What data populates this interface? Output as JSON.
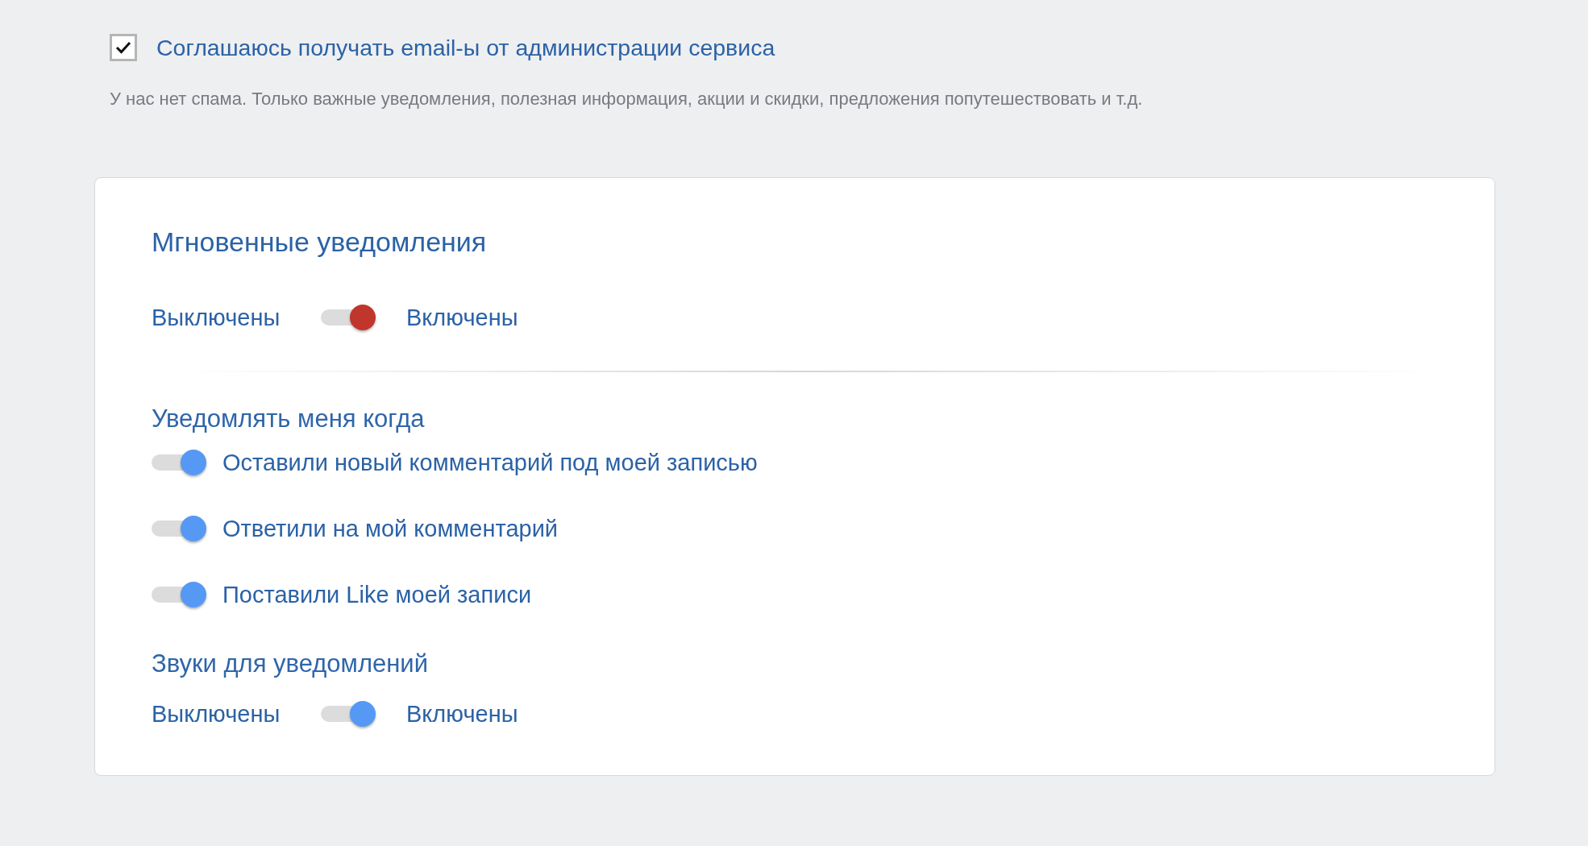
{
  "consent": {
    "label": "Соглашаюсь получать email-ы от администрации сервиса",
    "checked": true,
    "note": "У нас нет спама. Только важные уведомления, полезная информация, акции и скидки, предложения попутешествовать и т.д."
  },
  "card": {
    "title": "Мгновенные уведомления",
    "instant": {
      "off_label": "Выключены",
      "on_label": "Включены",
      "on": true,
      "color": "#c0362c"
    },
    "notify_heading": "Уведомлять меня когда",
    "events": [
      {
        "label": "Оставили новый комментарий под моей записью",
        "on": true,
        "color": "#5599f5"
      },
      {
        "label": "Ответили на мой комментарий",
        "on": true,
        "color": "#5599f5"
      },
      {
        "label": "Поставили Like моей записи",
        "on": true,
        "color": "#5599f5"
      }
    ],
    "sounds_heading": "Звуки для уведомлений",
    "sounds": {
      "off_label": "Выключены",
      "on_label": "Включены",
      "on": true,
      "color": "#5599f5"
    }
  }
}
